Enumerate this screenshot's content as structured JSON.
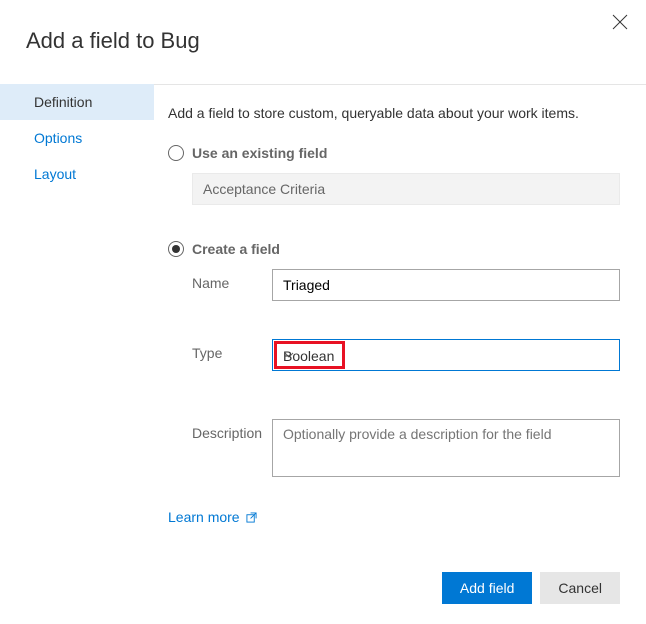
{
  "title": "Add a field to Bug",
  "tabs": {
    "definition": "Definition",
    "options": "Options",
    "layout": "Layout"
  },
  "content": {
    "description": "Add a field to store custom, queryable data about your work items.",
    "existing_label": "Use an existing field",
    "existing_value": "Acceptance Criteria",
    "create_label": "Create a field",
    "name_label": "Name",
    "name_value": "Triaged",
    "type_label": "Type",
    "type_value": "Boolean",
    "desc_label": "Description",
    "desc_placeholder": "Optionally provide a description for the field",
    "learn_more": "Learn more"
  },
  "footer": {
    "primary": "Add field",
    "cancel": "Cancel"
  }
}
